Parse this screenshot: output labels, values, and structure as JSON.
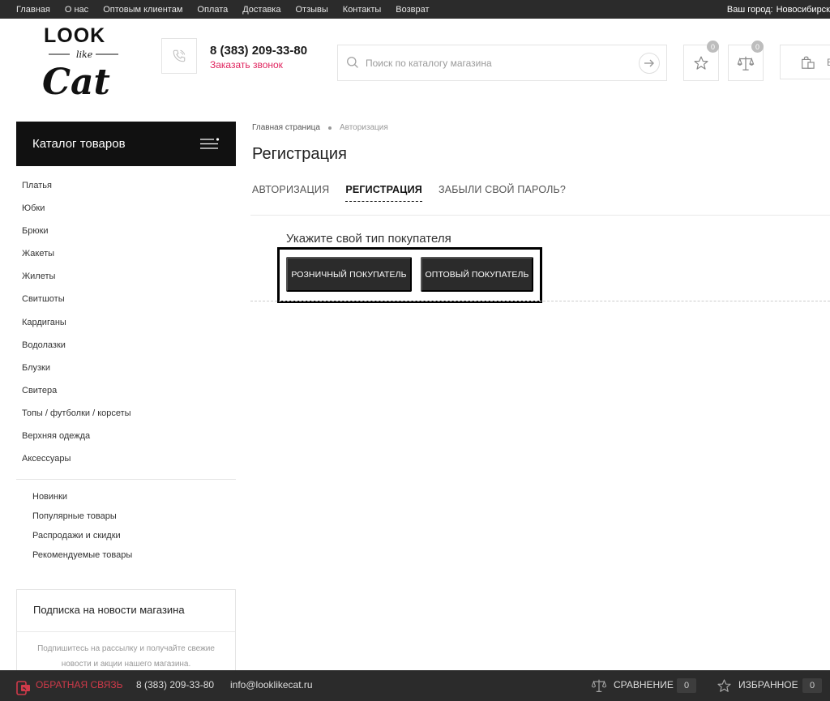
{
  "topbar": {
    "nav": [
      "Главная",
      "О нас",
      "Оптовым клиентам",
      "Оплата",
      "Доставка",
      "Отзывы",
      "Контакты",
      "Возврат"
    ],
    "city_label": "Ваш город:",
    "city_value": "Новосибирск"
  },
  "header": {
    "phone": "8 (383) 209-33-80",
    "callback": "Заказать звонок",
    "search_placeholder": "Поиск по каталогу магазина",
    "favorites_count": "0",
    "compare_count": "0",
    "cart_label": "В"
  },
  "logo": {
    "line1": "LOOK",
    "line2": "like",
    "line3": "Cat"
  },
  "sidebar": {
    "catalog_title": "Каталог товаров",
    "categories": [
      "Платья",
      "Юбки",
      "Брюки",
      "Жакеты",
      "Жилеты",
      "Свитшоты",
      "Кардиганы",
      "Водолазки",
      "Блузки",
      "Свитера",
      "Топы / футболки / корсеты",
      "Верхняя одежда",
      "Аксессуары"
    ],
    "extra": [
      "Новинки",
      "Популярные товары",
      "Распродажи и скидки",
      "Рекомендуемые товары"
    ],
    "subscribe_title": "Подписка на новости магазина",
    "subscribe_desc": "Подпишитесь на рассылку и получайте свежие новости и акции нашего магазина."
  },
  "main": {
    "breadcrumb": [
      "Главная страница",
      "Авторизация"
    ],
    "title": "Регистрация",
    "tabs": [
      "АВТОРИЗАЦИЯ",
      "РЕГИСТРАЦИЯ",
      "ЗАБЫЛИ СВОЙ ПАРОЛЬ?"
    ],
    "choose_label": "Укажите свой тип покупателя",
    "buttons": [
      "РОЗНИЧНЫЙ ПОКУПАТЕЛЬ",
      "ОПТОВЫЙ ПОКУПАТЕЛЬ"
    ]
  },
  "bottombar": {
    "feedback": "ОБРАТНАЯ СВЯЗЬ",
    "phone": "8 (383) 209-33-80",
    "email": "info@looklikecat.ru",
    "compare_label": "СРАВНЕНИЕ",
    "compare_count": "0",
    "favorites_label": "ИЗБРАННОЕ",
    "favorites_count": "0"
  },
  "colors": {
    "accent": "#e0245e",
    "dark": "#2b2b2b"
  }
}
